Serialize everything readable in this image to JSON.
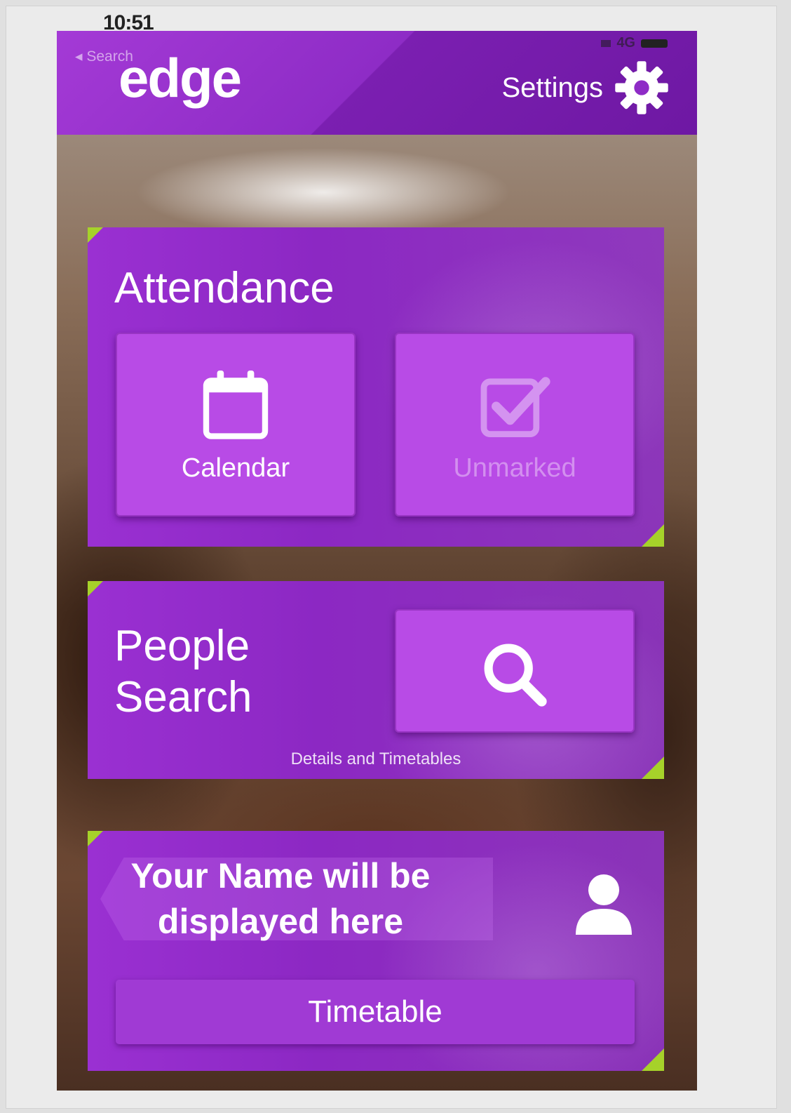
{
  "status_bar": {
    "time": "10:51",
    "network": "4G"
  },
  "header": {
    "back_label": "◂ Search",
    "logo_text": "edge",
    "settings_label": "Settings"
  },
  "attendance": {
    "title": "Attendance",
    "calendar_label": "Calendar",
    "unmarked_label": "Unmarked"
  },
  "people_search": {
    "title_line1": "People",
    "title_line2": "Search",
    "caption": "Details and Timetables"
  },
  "profile": {
    "name_line1": "Your Name will be",
    "name_line2": "displayed here",
    "timetable_label": "Timetable"
  },
  "colors": {
    "brand_purple": "#8e2cc6",
    "tile_purple": "#b84be6",
    "accent_green": "#a6d22a"
  },
  "icons": [
    "gear-icon",
    "calendar-icon",
    "checkbox-icon",
    "search-icon",
    "user-icon"
  ]
}
